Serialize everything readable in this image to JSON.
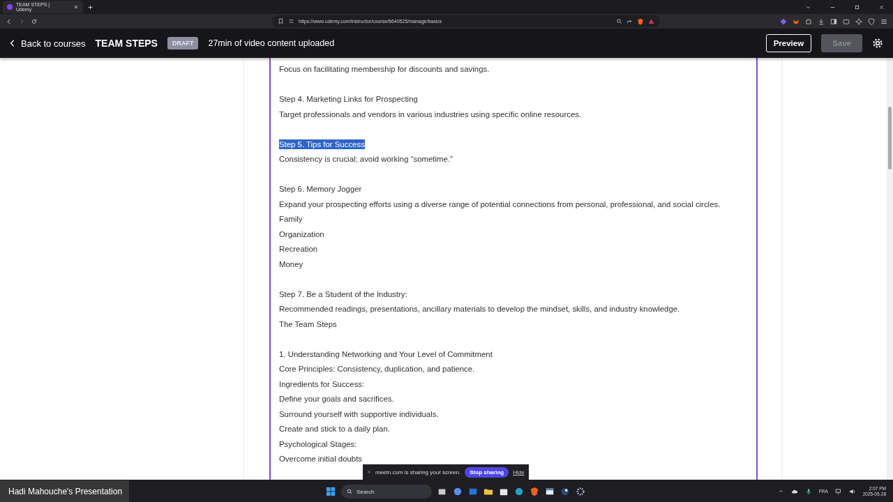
{
  "browser": {
    "tab": {
      "title": "TEAM STEPS | Udemy",
      "selected": true
    },
    "url": "https://www.udemy.com/instructor/course/6640525/manage/basics"
  },
  "header": {
    "back": "Back to courses",
    "title": "TEAM STEPS",
    "badge": "DRAFT",
    "status": "27min of video content uploaded",
    "preview": "Preview",
    "save": {
      "label": "Save",
      "disabled": true
    }
  },
  "content": {
    "blocks": [
      [
        {
          "text": "Focus on facilitating membership for discounts and savings.",
          "selected": false
        }
      ],
      [
        {
          "text": "Step 4. Marketing Links for Prospecting",
          "selected": false
        },
        {
          "text": "Target professionals and vendors in various industries using specific online resources.",
          "selected": false
        }
      ],
      [
        {
          "text": "Step 5. Tips for Success",
          "selected": true
        },
        {
          "text": "Consistency is crucial; avoid working “sometime.”",
          "selected": false
        }
      ],
      [
        {
          "text": "Step 6. Memory Jogger",
          "selected": false
        },
        {
          "text": "Expand your prospecting efforts using a diverse range of potential connections from personal, professional, and social circles.",
          "selected": false
        },
        {
          "text": "Family",
          "selected": false
        },
        {
          "text": "Organization",
          "selected": false
        },
        {
          "text": "Recreation",
          "selected": false
        },
        {
          "text": "Money",
          "selected": false
        }
      ],
      [
        {
          "text": "Step 7. Be a Student of the Industry:",
          "selected": false
        },
        {
          "text": "Recommended readings, presentations, ancillary materials to develop the mindset, skills, and industry knowledge.",
          "selected": false
        },
        {
          "text": "The Team Steps",
          "selected": false
        }
      ],
      [
        {
          "text": "1. Understanding Networking and Your Level of Commitment",
          "selected": false
        },
        {
          "text": "Core Principles: Consistency, duplication, and patience.",
          "selected": false
        },
        {
          "text": "Ingredients for Success:",
          "selected": false
        },
        {
          "text": "Define your goals and sacrifices.",
          "selected": false
        },
        {
          "text": "Surround yourself with supportive individuals.",
          "selected": false
        },
        {
          "text": "Create and stick to a daily plan.",
          "selected": false
        },
        {
          "text": "Psychological Stages:",
          "selected": false
        },
        {
          "text": "Overcome initial doubts",
          "selected": false
        }
      ]
    ]
  },
  "presenter": {
    "label": "Hadi Mahouche's Presentation"
  },
  "share_bar": {
    "message": "meetn.com is sharing your screen.",
    "stop": "Stop sharing",
    "hide": "Hide"
  },
  "taskbar": {
    "search": "Search",
    "language": "FRA",
    "time": "2:07 PM",
    "date": "2025-05-28"
  }
}
